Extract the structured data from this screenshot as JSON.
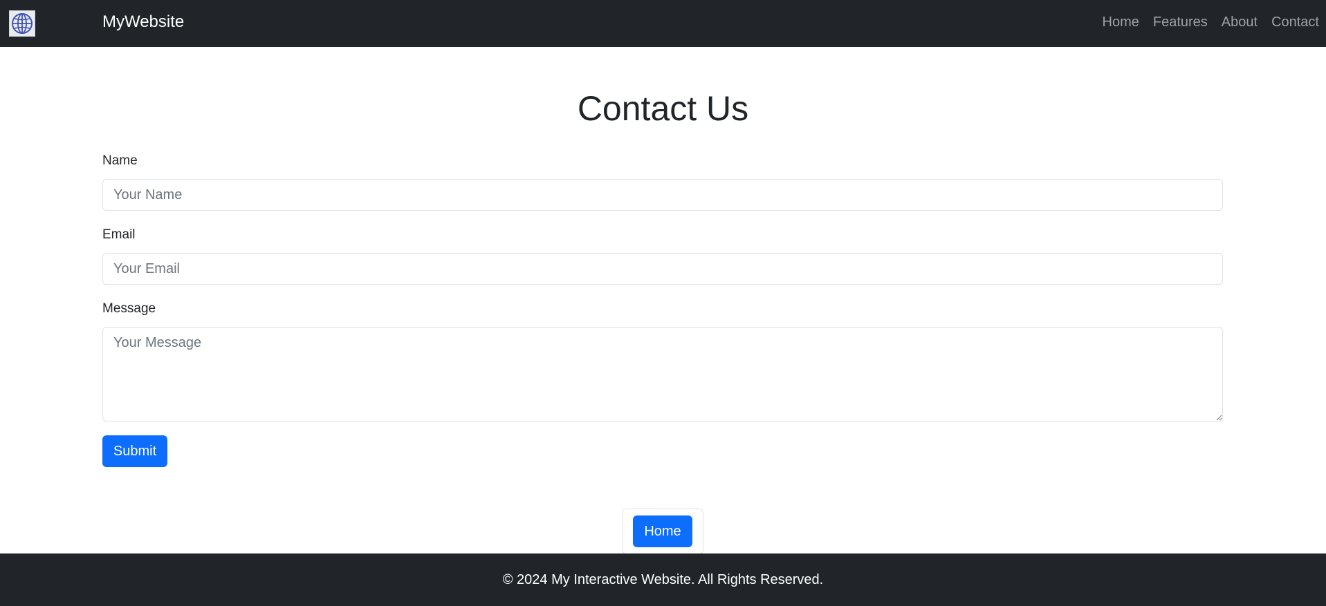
{
  "navbar": {
    "brand": "MyWebsite",
    "logo_icon": "globe-icon",
    "links": [
      {
        "label": "Home"
      },
      {
        "label": "Features"
      },
      {
        "label": "About"
      },
      {
        "label": "Contact"
      }
    ]
  },
  "main": {
    "title": "Contact Us",
    "form": {
      "name_label": "Name",
      "name_placeholder": "Your Name",
      "email_label": "Email",
      "email_placeholder": "Your Email",
      "message_label": "Message",
      "message_placeholder": "Your Message",
      "submit_label": "Submit"
    },
    "home_button_label": "Home"
  },
  "footer": {
    "text": "© 2024 My Interactive Website. All Rights Reserved."
  },
  "colors": {
    "navbar_bg": "#212529",
    "primary": "#0d6efd",
    "nav_link": "#9ea2a6",
    "logo_icon": "#3f51b5"
  }
}
